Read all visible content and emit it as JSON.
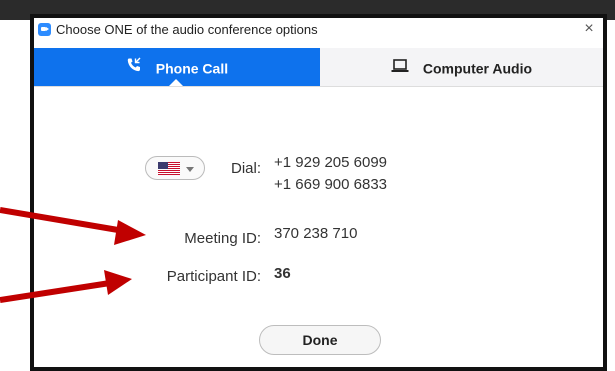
{
  "dialog": {
    "title": "Choose ONE of the audio conference options",
    "close_glyph": "×",
    "app_icon": "zoom-camera-icon"
  },
  "tabs": [
    {
      "label": "Phone Call",
      "icon": "phone-icon",
      "selected": true
    },
    {
      "label": "Computer Audio",
      "icon": "laptop-icon",
      "selected": false
    }
  ],
  "dial": {
    "label": "Dial:",
    "country_flag": "us-flag-icon",
    "numbers": [
      "+1 929 205 6099",
      "+1 669 900 6833"
    ]
  },
  "meeting": {
    "label": "Meeting ID:",
    "value": "370 238 710"
  },
  "participant": {
    "label": "Participant ID:",
    "value": "36"
  },
  "actions": {
    "done_label": "Done"
  },
  "colors": {
    "accent": "#0e72ed",
    "annotation_arrow": "#c00000"
  }
}
